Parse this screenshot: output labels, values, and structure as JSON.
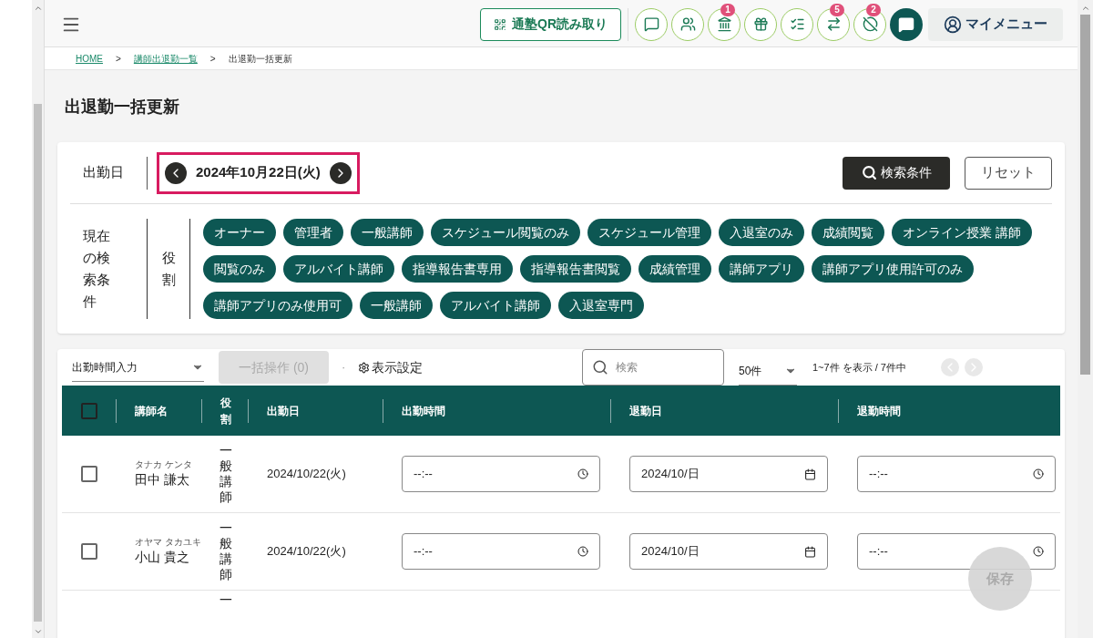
{
  "header": {
    "qr_button": "通塾QR読み取り",
    "icon_buttons": [
      {
        "kind": "message"
      },
      {
        "kind": "group"
      },
      {
        "kind": "school",
        "badge": "1"
      },
      {
        "kind": "gift"
      },
      {
        "kind": "checklist"
      },
      {
        "kind": "arrows",
        "badge": "5"
      },
      {
        "kind": "off",
        "badge": "2"
      },
      {
        "kind": "chat"
      }
    ],
    "my_menu": "マイメニュー"
  },
  "breadcrumb": [
    {
      "label": "HOME",
      "link": true
    },
    {
      "label": ">",
      "link": false
    },
    {
      "label": "講師出退勤一覧",
      "link": true
    },
    {
      "label": ">",
      "link": false
    },
    {
      "label": "出退勤一括更新",
      "link": false
    }
  ],
  "page_title": "出退勤一括更新",
  "search_card": {
    "date_label": "出勤日",
    "date": "2024年10月22日(火)",
    "search_button": "検索条件",
    "reset_button": "リセット",
    "conditions_label": "現在の検索条件",
    "role_label": "役割",
    "tags": [
      "オーナー",
      "管理者",
      "一般講師",
      "スケジュール閲覧のみ",
      "スケジュール管理",
      "入退室のみ",
      "成績閲覧",
      "オンライン授業 講師",
      "閲覧のみ",
      "アルバイト講師",
      "指導報告書専用",
      "指導報告書閲覧",
      "成績管理",
      "講師アプリ",
      "講師アプリ使用許可のみ",
      "講師アプリのみ使用可",
      "一般講師",
      "アルバイト講師",
      "入退室専門"
    ]
  },
  "toolbar": {
    "mode_select": "出勤時間入力",
    "bulk_button": "一括操作 (0)",
    "bulk_disabled": true,
    "dot": "·",
    "display_settings": "表示設定",
    "search_placeholder": "検索",
    "per_page": "50件",
    "range": "1~7件 を表示 / 7件中"
  },
  "table": {
    "select_all_checked": false,
    "columns": [
      "講師名",
      "役割",
      "出勤日",
      "出勤時間",
      "退勤日",
      "退勤時間"
    ],
    "rows": [
      {
        "checked": false,
        "kana": "タナカ ケンタ",
        "name": "田中 謙太",
        "role": "一般講師",
        "date": "2024/10/22(火)",
        "in_time": "--:--",
        "out_date": "2024/10/日",
        "out_time": "--:--"
      },
      {
        "checked": false,
        "kana": "オヤマ タカユキ",
        "name": "小山 貴之",
        "role": "一般講師",
        "date": "2024/10/22(火)",
        "in_time": "--:--",
        "out_date": "2024/10/日",
        "out_time": "--:--"
      },
      {
        "role": "一"
      }
    ]
  },
  "save_button": "保存"
}
